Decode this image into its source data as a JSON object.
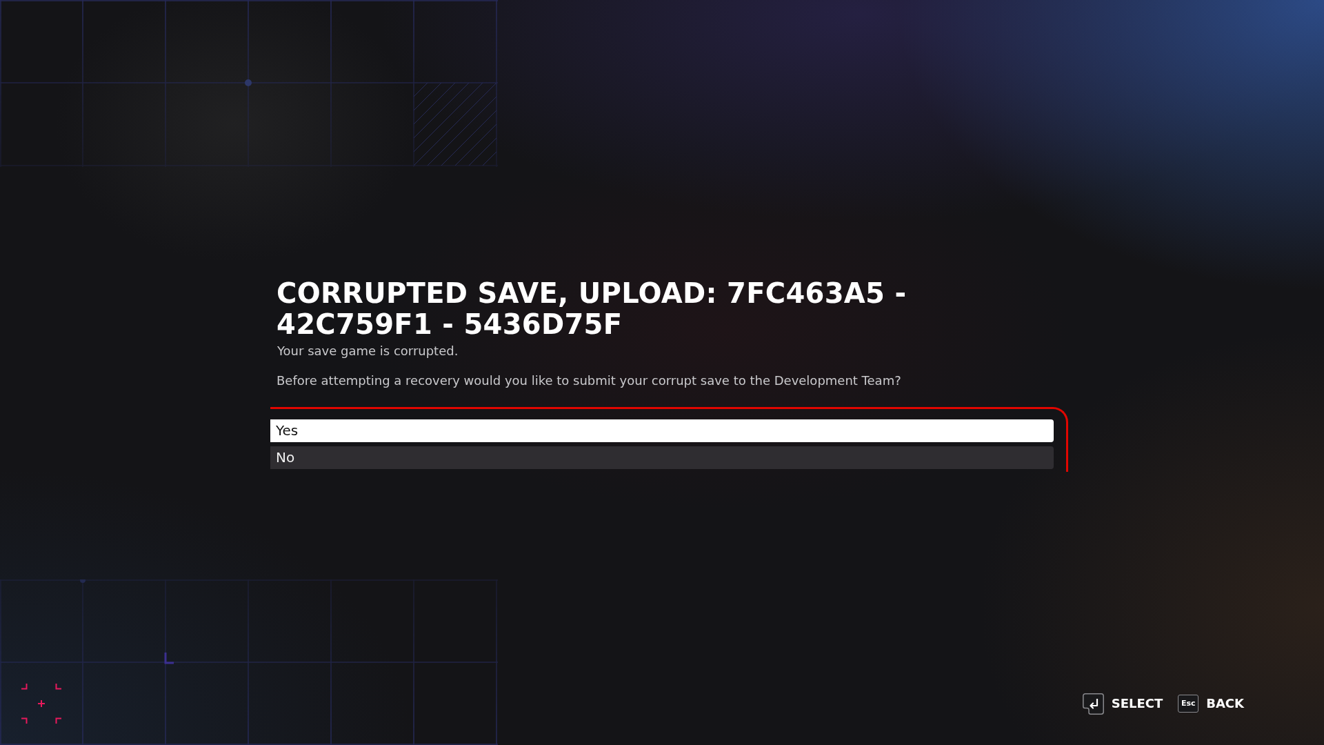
{
  "dialog": {
    "title": "CORRUPTED SAVE, UPLOAD: 7FC463A5 - 42C759F1 - 5436D75F",
    "subtitle": "Your save game is corrupted.",
    "message": "Before attempting a recovery would you like to submit your corrupt save to the Development Team?",
    "options": [
      {
        "label": "Yes",
        "selected": true
      },
      {
        "label": "No",
        "selected": false
      }
    ]
  },
  "footer": {
    "prompts": [
      {
        "kind": "enter",
        "label": "SELECT"
      },
      {
        "kind": "key",
        "key": "Esc",
        "label": "BACK"
      }
    ]
  }
}
